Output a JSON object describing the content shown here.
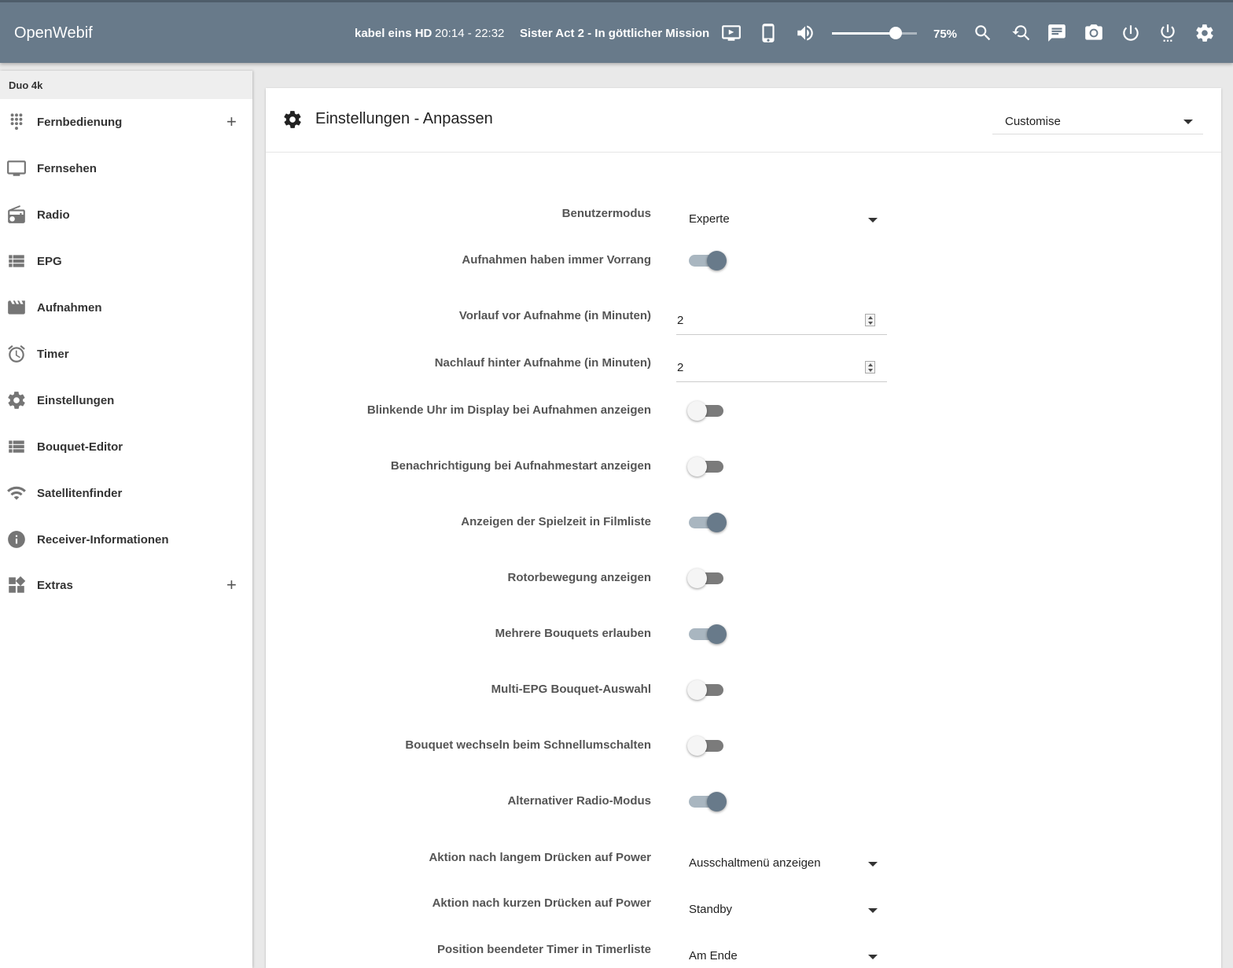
{
  "app": {
    "title": "OpenWebif"
  },
  "now_playing": {
    "channel": "kabel eins HD",
    "time": "20:14 - 22:32",
    "program": "Sister Act 2 - In göttlicher Mission"
  },
  "volume": {
    "level": 75,
    "label": "75%"
  },
  "toolbar_icons": [
    "tv-player-icon",
    "mobile-icon",
    "volume-icon",
    "search-icon",
    "zoom-epg-icon",
    "message-icon",
    "screenshot-icon",
    "power-icon",
    "power-menu-icon",
    "settings-icon"
  ],
  "sidebar": {
    "device": "Duo 4k",
    "items": [
      {
        "label": "Fernbedienung",
        "icon": "remote-dots-icon",
        "expandable": true
      },
      {
        "label": "Fernsehen",
        "icon": "tv-icon",
        "expandable": false
      },
      {
        "label": "Radio",
        "icon": "radio-icon",
        "expandable": false
      },
      {
        "label": "EPG",
        "icon": "list-icon",
        "expandable": false
      },
      {
        "label": "Aufnahmen",
        "icon": "clapperboard-icon",
        "expandable": false
      },
      {
        "label": "Timer",
        "icon": "alarm-icon",
        "expandable": false
      },
      {
        "label": "Einstellungen",
        "icon": "gear-icon",
        "expandable": false
      },
      {
        "label": "Bouquet-Editor",
        "icon": "list-icon",
        "expandable": false
      },
      {
        "label": "Satellitenfinder",
        "icon": "wifi-icon",
        "expandable": false
      },
      {
        "label": "Receiver-Informationen",
        "icon": "info-icon",
        "expandable": false
      },
      {
        "label": "Extras",
        "icon": "widgets-icon",
        "expandable": true
      }
    ],
    "plus_symbol": "+"
  },
  "page": {
    "title": "Einstellungen - Anpassen",
    "section_select": "Customise"
  },
  "settings": [
    {
      "type": "select",
      "label": "Benutzermodus",
      "value": "Experte"
    },
    {
      "type": "toggle",
      "label": "Aufnahmen haben immer Vorrang",
      "on": true
    },
    {
      "type": "number",
      "label": "Vorlauf vor Aufnahme (in Minuten)",
      "value": "2"
    },
    {
      "type": "number",
      "label": "Nachlauf hinter Aufnahme (in Minuten)",
      "value": "2"
    },
    {
      "type": "toggle",
      "label": "Blinkende Uhr im Display bei Aufnahmen anzeigen",
      "on": false
    },
    {
      "type": "toggle",
      "label": "Benachrichtigung bei Aufnahmestart anzeigen",
      "on": false
    },
    {
      "type": "toggle",
      "label": "Anzeigen der Spielzeit in Filmliste",
      "on": true
    },
    {
      "type": "toggle",
      "label": "Rotorbewegung anzeigen",
      "on": false
    },
    {
      "type": "toggle",
      "label": "Mehrere Bouquets erlauben",
      "on": true
    },
    {
      "type": "toggle",
      "label": "Multi-EPG Bouquet-Auswahl",
      "on": false
    },
    {
      "type": "toggle",
      "label": "Bouquet wechseln beim Schnellumschalten",
      "on": false
    },
    {
      "type": "toggle",
      "label": "Alternativer Radio-Modus",
      "on": true
    },
    {
      "type": "select",
      "label": "Aktion nach langem Drücken auf Power",
      "value": "Ausschaltmenü anzeigen"
    },
    {
      "type": "select",
      "label": "Aktion nach kurzen Drücken auf Power",
      "value": "Standby"
    },
    {
      "type": "select",
      "label": "Position beendeter Timer in Timerliste",
      "value": "Am Ende"
    }
  ],
  "colors": {
    "topbar": "#687a8a",
    "accent": "#687a8a"
  }
}
